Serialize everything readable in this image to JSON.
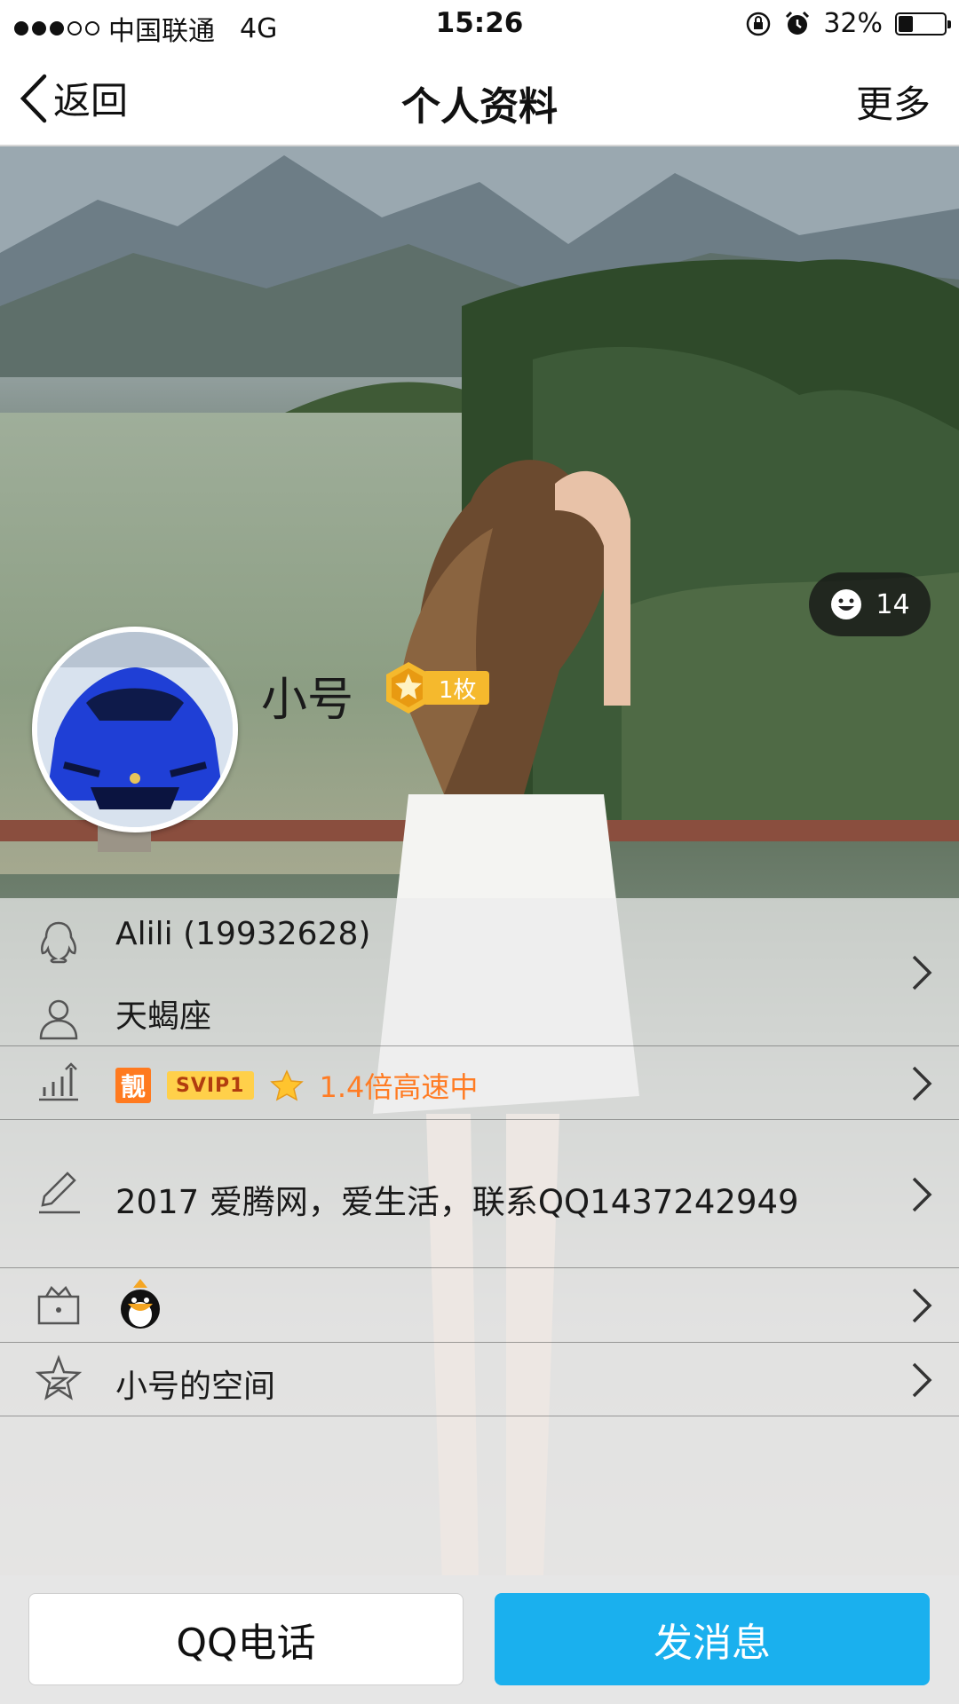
{
  "status_bar": {
    "carrier": "中国联通",
    "network": "4G",
    "time": "15:26",
    "battery_percent": "32%",
    "battery_level": 0.32,
    "signal_bars": 3
  },
  "nav": {
    "back_label": "返回",
    "title": "个人资料",
    "more_label": "更多"
  },
  "profile": {
    "like_count": "14",
    "nickname": "小号",
    "badge_label": "1枚"
  },
  "rows": {
    "account": "Alili (19932628)",
    "zodiac": "天蝎座",
    "vip_liang": "靓",
    "vip_svip": "SVIP1",
    "vip_speed": "1.4倍高速中",
    "signature": "2017 爱腾网，爱生活，联系QQ1437242949",
    "space": "小号的空间"
  },
  "actions": {
    "call_label": "QQ电话",
    "message_label": "发消息"
  },
  "colors": {
    "accent_blue": "#1ab0ee",
    "vip_orange": "#ff7c24",
    "badge_gold": "#f5b92d"
  }
}
